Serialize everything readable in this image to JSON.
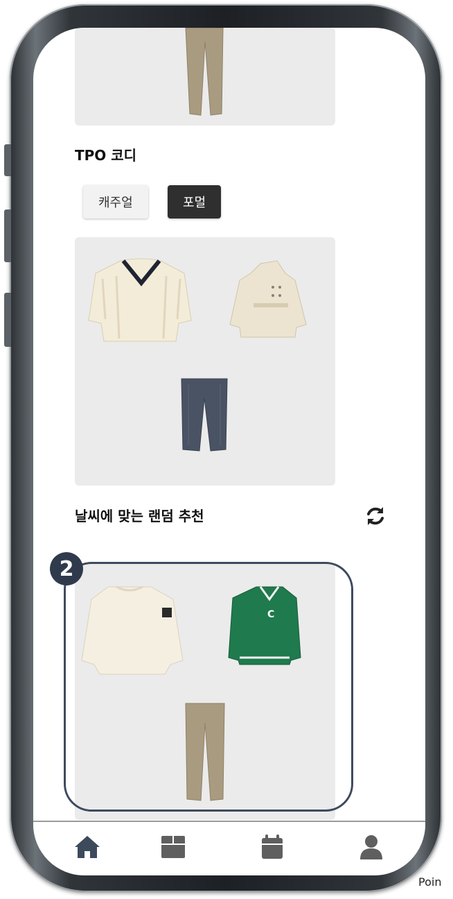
{
  "tpo_section": {
    "title": "TPO 코디"
  },
  "tabs": [
    {
      "label": "캐주얼",
      "selected": false
    },
    {
      "label": "포멀",
      "selected": true
    }
  ],
  "random_section": {
    "title": "날씨에 맞는 랜덤 추천"
  },
  "badge": {
    "number": "2"
  },
  "bottom_nav": {
    "items": [
      {
        "icon": "home-icon",
        "active": true
      },
      {
        "icon": "box-icon",
        "active": false
      },
      {
        "icon": "calendar-icon",
        "active": false
      },
      {
        "icon": "user-icon",
        "active": false
      }
    ]
  },
  "colors": {
    "accent_dark": "#2f2f2f",
    "highlight_border": "#3e4a5e",
    "card_bg": "#ebebeb",
    "nav_icon": "#5f5f5f",
    "nav_icon_active": "#3d4a5c"
  },
  "footer_fragment": "Poin"
}
